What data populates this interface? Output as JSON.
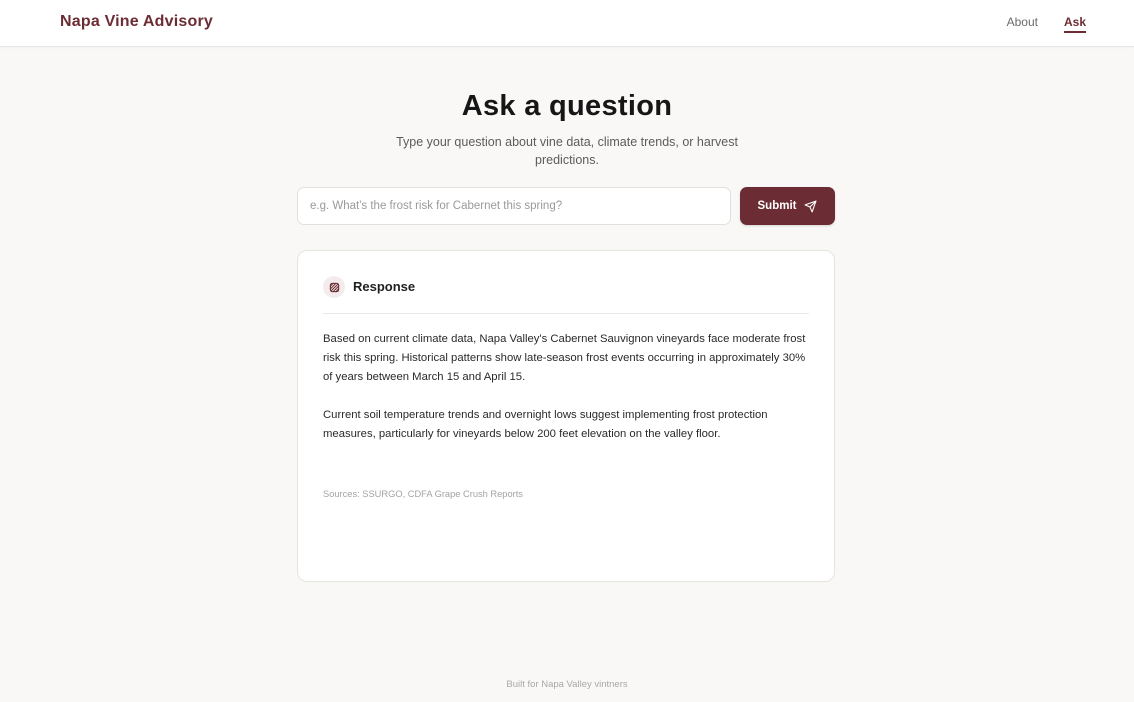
{
  "header": {
    "brand": "Napa Vine Advisory",
    "nav": [
      {
        "label": "About",
        "active": false
      },
      {
        "label": "Ask",
        "active": true
      }
    ]
  },
  "hero": {
    "title": "Ask a question",
    "subtitle": "Type your question about vine data, climate trends, or harvest predictions."
  },
  "search": {
    "placeholder": "e.g. What's the frost risk for Cabernet this spring?",
    "value": "",
    "submit_label": "Submit",
    "submit_icon": "send-icon"
  },
  "response": {
    "icon": "grape-icon",
    "title": "Response",
    "paragraphs": [
      "Based on current climate data, Napa Valley's Cabernet Sauvignon vineyards face moderate frost risk this spring. Historical patterns show late-season frost events occurring in approximately 30% of years between March 15 and April 15.",
      "Current soil temperature trends and overnight lows suggest implementing frost protection measures, particularly for vineyards below 200 feet elevation on the valley floor."
    ],
    "sources": "Sources: SSURGO, CDFA Grape Crush Reports"
  },
  "footer": {
    "text": "Built for Napa Valley vintners"
  },
  "colors": {
    "accent": "#6b2d33",
    "background": "#f9f8f6",
    "card": "#ffffff"
  }
}
